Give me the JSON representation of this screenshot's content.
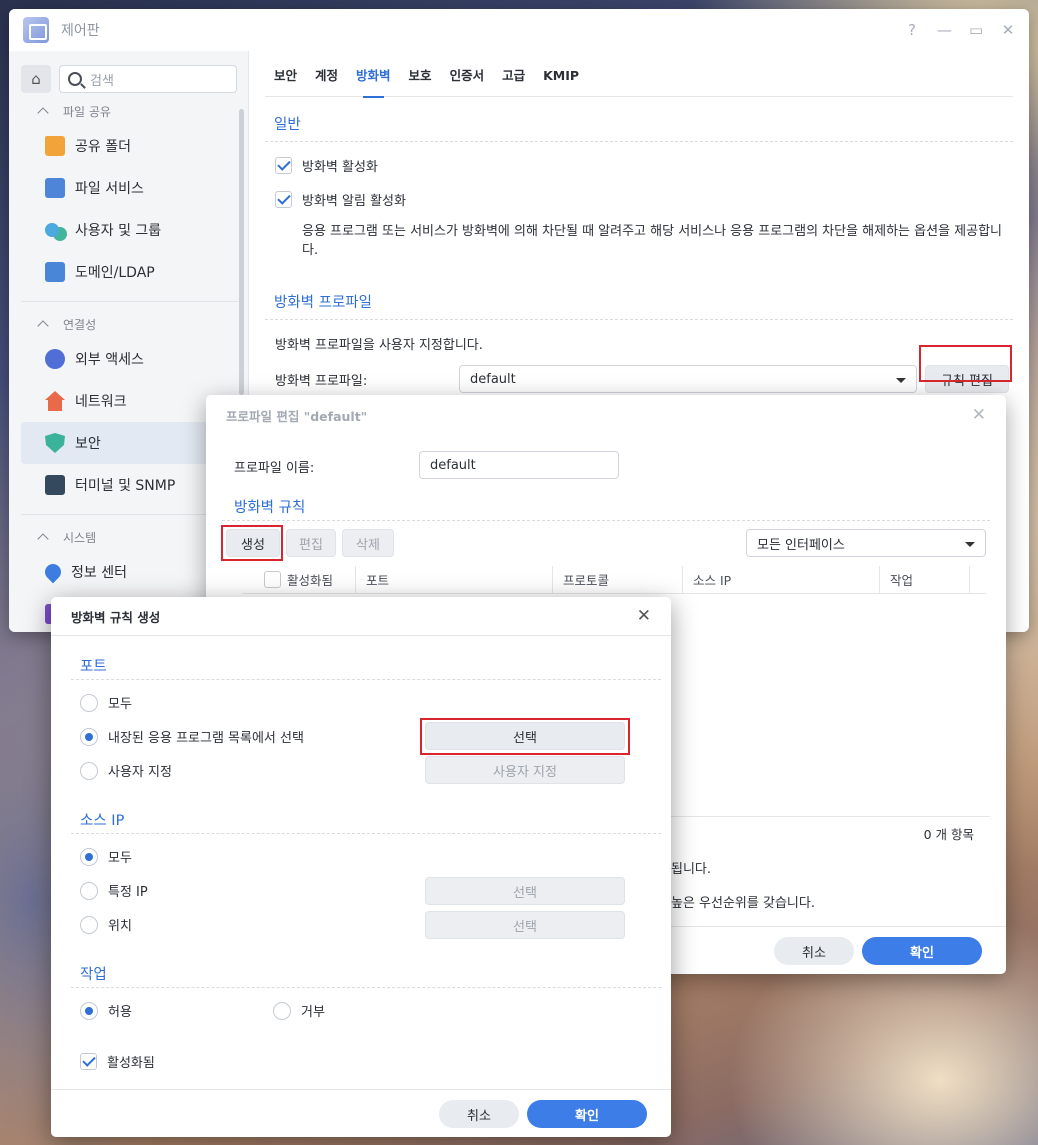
{
  "window": {
    "title": "제어판",
    "help": "?",
    "minimize": "—",
    "maximize": "▭",
    "close": "✕"
  },
  "sidebar": {
    "search_placeholder": "검색",
    "sections": [
      {
        "label": "파일 공유",
        "items": [
          "공유 폴더",
          "파일 서비스",
          "사용자 및 그룹",
          "도메인/LDAP"
        ]
      },
      {
        "label": "연결성",
        "items": [
          "외부 액세스",
          "네트워크",
          "보안",
          "터미널 및 SNMP"
        ]
      },
      {
        "label": "시스템",
        "items": [
          "정보 센터"
        ]
      }
    ]
  },
  "tabs": [
    "보안",
    "계정",
    "방화벽",
    "보호",
    "인증서",
    "고급",
    "KMIP"
  ],
  "general": {
    "title": "일반",
    "enable_firewall": "방화벽 활성화",
    "enable_notifications": "방화벽 알림 활성화",
    "description": "응용 프로그램 또는 서비스가 방화벽에 의해 차단될 때 알려주고 해당 서비스나 응용 프로그램의 차단을 해제하는 옵션을 제공합니다."
  },
  "profile": {
    "title": "방화벽 프로파일",
    "description": "방화벽 프로파일을 사용자 지정합니다.",
    "label": "방화벽 프로파일:",
    "value": "default",
    "edit_rules": "규칙 편집"
  },
  "profile_dialog": {
    "title": "프로파일 편집 \"default\"",
    "name_label": "프로파일 이름:",
    "name_value": "default",
    "rules_title": "방화벽 규칙",
    "create": "생성",
    "edit": "편집",
    "delete": "삭제",
    "interface": "모든 인터페이스",
    "columns": [
      "활성화됨",
      "포트",
      "프로토콜",
      "소스 IP",
      "작업"
    ],
    "count": "0 개 항목",
    "note1": "됩니다.",
    "note2": "높은 우선순위를 갖습니다.",
    "cancel": "취소",
    "ok": "확인"
  },
  "rule_dialog": {
    "title": "방화벽 규칙 생성",
    "port_title": "포트",
    "port_all": "모두",
    "port_builtin": "내장된 응용 프로그램 목록에서 선택",
    "port_custom": "사용자 지정",
    "select": "선택",
    "custom_button": "사용자 지정",
    "source_title": "소스 IP",
    "source_all": "모두",
    "source_specific": "특정 IP",
    "source_location": "위치",
    "action_title": "작업",
    "allow": "허용",
    "deny": "거부",
    "enabled": "활성화됨",
    "cancel": "취소",
    "ok": "확인"
  }
}
